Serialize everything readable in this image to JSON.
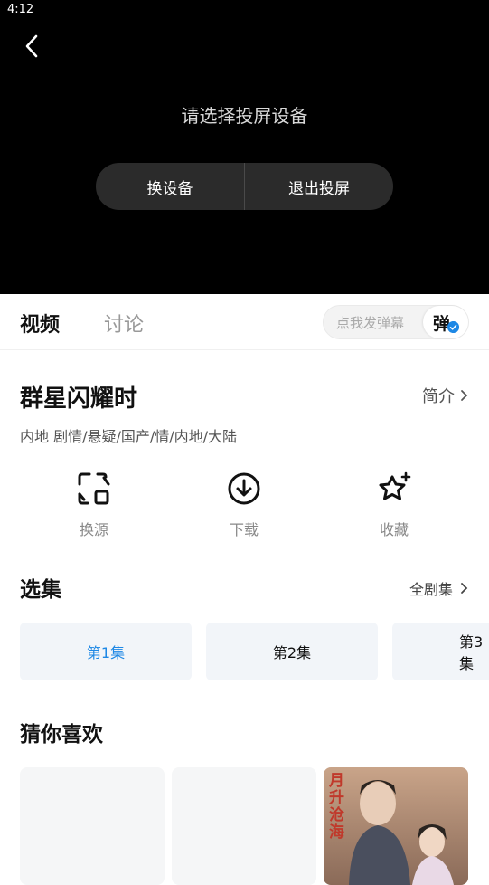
{
  "status_bar": {
    "time": "4:12"
  },
  "player": {
    "cast_prompt": "请选择投屏设备",
    "change_device_label": "换设备",
    "exit_cast_label": "退出投屏"
  },
  "tabs": {
    "video": "视频",
    "discussion": "讨论"
  },
  "danmu": {
    "placeholder": "点我发弹幕",
    "toggle_label": "弹"
  },
  "show": {
    "title": "群星闪耀时",
    "intro_label": "简介",
    "tags": "内地  剧情/悬疑/国产/情/内地/大陆"
  },
  "actions": [
    {
      "label": "换源",
      "icon": "switch-source-icon"
    },
    {
      "label": "下载",
      "icon": "download-icon"
    },
    {
      "label": "收藏",
      "icon": "star-icon"
    }
  ],
  "episodes": {
    "section_title": "选集",
    "all_label": "全剧集",
    "items": [
      "第1集",
      "第2集",
      "第3集"
    ],
    "active_index": 0
  },
  "recommend": {
    "section_title": "猜你喜欢",
    "poster_title": "月升沧海"
  },
  "colors": {
    "accent": "#1e88e5",
    "player_bg": "#000000"
  }
}
